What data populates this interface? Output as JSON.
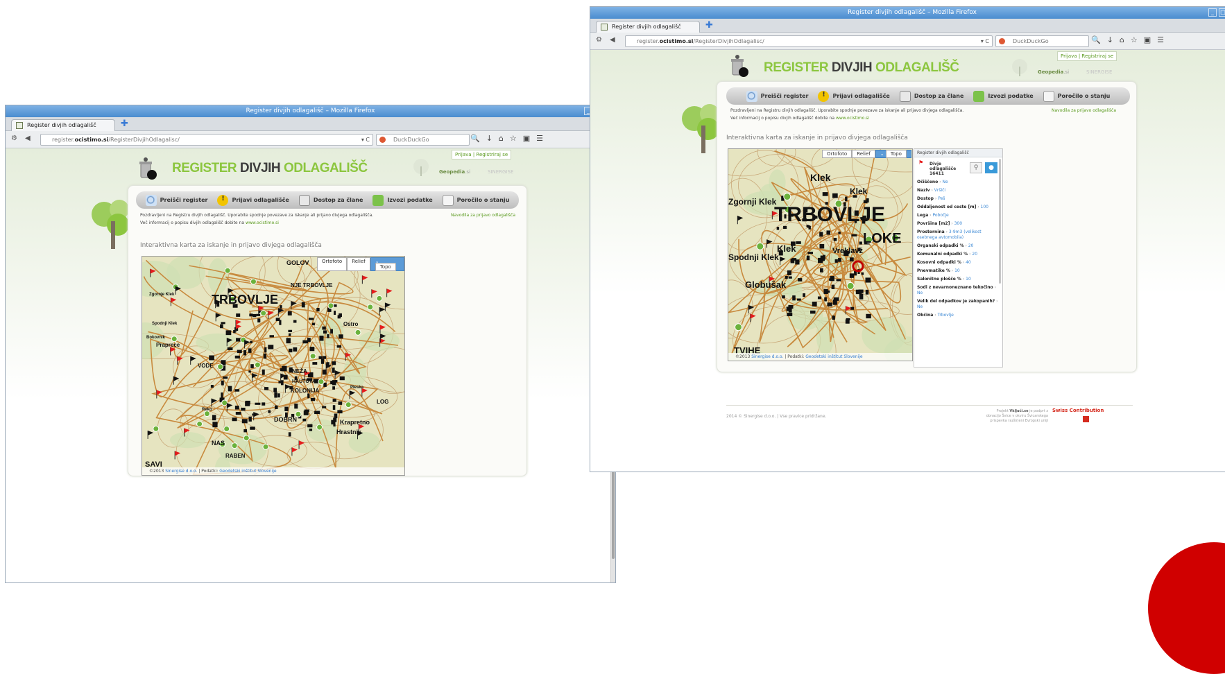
{
  "browser": {
    "window_title": "Register divjih odlagališč – Mozilla Firefox",
    "tab_title": "Register divjih odlagališč",
    "url_host": "register.ocistimo.si",
    "url_prefix": "register.",
    "url_domain": "ocistimo.si",
    "url_path": "/RegisterDivjihOdlagalisc/",
    "search_placeholder": "DuckDuckGo"
  },
  "site": {
    "logo_part1": "REGISTER",
    "logo_part2": "DIVJIH",
    "logo_part3": "ODLAGALIŠČ",
    "login_text": "Prijava | Registriraj se",
    "partner1": "Geopedia",
    "partner1_suffix": ".si",
    "partner2": "SINERGISE",
    "menu": [
      {
        "label": "Preišči register",
        "icon": "search-icon"
      },
      {
        "label": "Prijavi odlagališče",
        "icon": "warning-icon"
      },
      {
        "label": "Dostop za člane",
        "icon": "members-icon"
      },
      {
        "label": "Izvozi podatke",
        "icon": "export-icon"
      },
      {
        "label": "Poročilo o stanju",
        "icon": "report-icon"
      }
    ],
    "intro_line1": "Pozdravljeni na Registru divjih odlagališč. Uporabite spodnje povezave za iskanje ali prijavo divjega odlagališča.",
    "intro_line2_prefix": "Več informacij o popisu divjih odlagališč dobite na",
    "intro_link": "www.ocistimo.si",
    "guide_link": "Navodila za prijavo odlagališča",
    "map_title": "Interaktivna karta za iskanje in prijavo divjega odlagališča",
    "map_layers": [
      "Ortofoto",
      "Relief",
      "Topo"
    ],
    "map_active_layer": "Topo",
    "attribution_prefix": "©2013",
    "attribution_company": "Sinergise d.o.o.",
    "attribution_mid": "| Podatki:",
    "attribution_source": "Geodetski inštitut Slovenije",
    "footer_copyright": "2014 © Sinergise d.o.o. | Vse pravice pridržane.",
    "project_line1_prefix": "Projekt",
    "project_site": "Vključi.se",
    "project_line1_suffix": "je podprt z",
    "project_line2": "donacijo Švice v okviru Švicarskega",
    "project_line3": "prispevka razširjeni Evropski uniji",
    "swiss_label": "Swiss Contribution"
  },
  "map_a": {
    "labels": [
      "TRBOVLJE",
      "GOLOV",
      "NJE TRBOVLJE",
      "Ostro",
      "Praprece",
      "VODE",
      "NEŽA",
      "KOLONIJA",
      "DOBRN",
      "Krapretno",
      "Hrastnik",
      "NAS",
      "RABEN",
      "SAVI",
      "Zgornje Klek",
      "Spodnji Klek",
      "Bokovnik",
      "Reko",
      "Pleska",
      "LOG",
      "HAUTOVA"
    ]
  },
  "map_b": {
    "labels": [
      "TRBOVLJE",
      "LOKE",
      "Klek",
      "Klek",
      "Zgornji Klek",
      "Spodnji Klek",
      "Globušak",
      "Vreklavž",
      "TVIHE",
      "Klek"
    ]
  },
  "info_panel": {
    "title": "Register divjih odlagališč",
    "item_name": "Divje odlagališče",
    "item_id": "16411",
    "fields": [
      {
        "label": "Očiščeno",
        "value": "Ne"
      },
      {
        "label": "Naziv",
        "value": "Vršiči"
      },
      {
        "label": "Dostop",
        "value": "Peš"
      },
      {
        "label": "Oddaljenost od ceste [m]",
        "value": "100"
      },
      {
        "label": "Lega",
        "value": "Pobočje"
      },
      {
        "label": "Površina [m2]",
        "value": "300"
      },
      {
        "label": "Prostornina",
        "value": "3-9m3 (velikost osebnega avtomobila)"
      },
      {
        "label": "Organski odpadki %",
        "value": "20"
      },
      {
        "label": "Komunalni odpadki %",
        "value": "20"
      },
      {
        "label": "Kosovni odpadki %",
        "value": "40"
      },
      {
        "label": "Pnevmatike %",
        "value": "10"
      },
      {
        "label": "Salonitne plošče %",
        "value": "10"
      },
      {
        "label": "Sodi z nevarnoneznano tekočino",
        "value": "Ne"
      },
      {
        "label": "Velik del odpadkov je zakopanih?",
        "value": "Ne"
      },
      {
        "label": "Občina",
        "value": "Trbovlje"
      }
    ]
  },
  "colors": {
    "accent_green": "#8cc63f",
    "flag_red": "#e41c1c",
    "topo_active": "#5c9bd7"
  }
}
